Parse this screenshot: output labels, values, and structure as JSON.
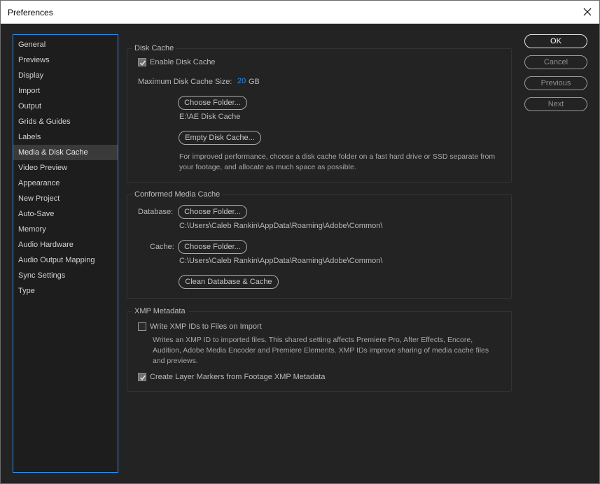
{
  "window": {
    "title": "Preferences"
  },
  "sidebar": {
    "items": [
      {
        "label": "General"
      },
      {
        "label": "Previews"
      },
      {
        "label": "Display"
      },
      {
        "label": "Import"
      },
      {
        "label": "Output"
      },
      {
        "label": "Grids & Guides"
      },
      {
        "label": "Labels"
      },
      {
        "label": "Media & Disk Cache",
        "selected": true
      },
      {
        "label": "Video Preview"
      },
      {
        "label": "Appearance"
      },
      {
        "label": "New Project"
      },
      {
        "label": "Auto-Save"
      },
      {
        "label": "Memory"
      },
      {
        "label": "Audio Hardware"
      },
      {
        "label": "Audio Output Mapping"
      },
      {
        "label": "Sync Settings"
      },
      {
        "label": "Type"
      }
    ]
  },
  "disk_cache": {
    "group_label": "Disk Cache",
    "enable_label": "Enable Disk Cache",
    "enable_checked": true,
    "max_size_label": "Maximum Disk Cache Size:",
    "max_size_value": "20",
    "max_size_unit": "GB",
    "choose_folder": "Choose Folder...",
    "folder_path": "E:\\AE Disk Cache",
    "empty_button": "Empty Disk Cache...",
    "hint": "For improved performance, choose a disk cache folder on a fast hard drive or SSD separate from your footage, and allocate as much space as possible."
  },
  "conformed": {
    "group_label": "Conformed Media Cache",
    "database_label": "Database:",
    "database_button": "Choose Folder...",
    "database_path": "C:\\Users\\Caleb Rankin\\AppData\\Roaming\\Adobe\\Common\\",
    "cache_label": "Cache:",
    "cache_button": "Choose Folder...",
    "cache_path": "C:\\Users\\Caleb Rankin\\AppData\\Roaming\\Adobe\\Common\\",
    "clean_button": "Clean Database & Cache"
  },
  "xmp": {
    "group_label": "XMP Metadata",
    "write_label": "Write XMP IDs to Files on Import",
    "write_checked": false,
    "write_hint": "Writes an XMP ID to imported files. This shared setting affects Premiere Pro, After Effects, Encore, Audition, Adobe Media Encoder and Premiere Elements. XMP IDs improve sharing of media cache files and previews.",
    "markers_label": "Create Layer Markers from Footage XMP Metadata",
    "markers_checked": true
  },
  "actions": {
    "ok": "OK",
    "cancel": "Cancel",
    "previous": "Previous",
    "next": "Next"
  },
  "colors": {
    "accent": "#2d8ceb",
    "panel_bg": "#232323",
    "sidebar_bg": "#1d1d1d"
  }
}
